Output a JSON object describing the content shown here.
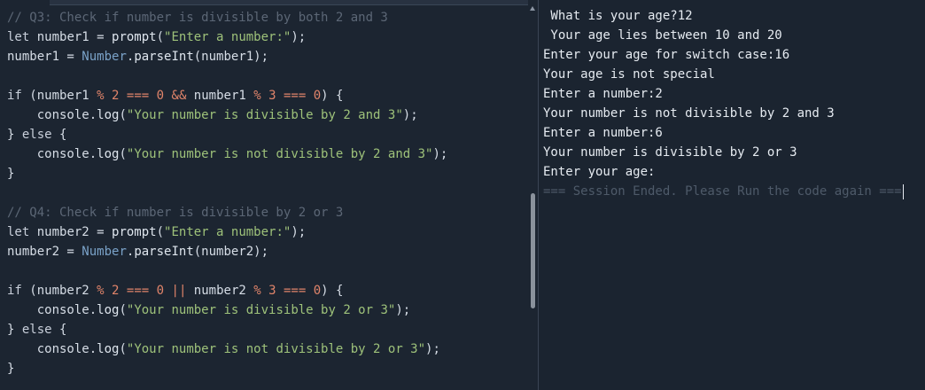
{
  "editor": {
    "lines": [
      [
        {
          "t": "comment",
          "v": "// Q3: Check if number is divisible by both 2 and 3"
        }
      ],
      [
        {
          "t": "keyword",
          "v": "let"
        },
        {
          "t": "plain",
          "v": " number1 = "
        },
        {
          "t": "func",
          "v": "prompt"
        },
        {
          "t": "punc",
          "v": "("
        },
        {
          "t": "string",
          "v": "\"Enter a number:\""
        },
        {
          "t": "punc",
          "v": ");"
        }
      ],
      [
        {
          "t": "plain",
          "v": "number1 = "
        },
        {
          "t": "class",
          "v": "Number"
        },
        {
          "t": "plain",
          "v": "."
        },
        {
          "t": "func",
          "v": "parseInt"
        },
        {
          "t": "punc",
          "v": "(number1);"
        }
      ],
      [],
      [
        {
          "t": "keyword",
          "v": "if"
        },
        {
          "t": "plain",
          "v": " (number1 "
        },
        {
          "t": "op",
          "v": "%"
        },
        {
          "t": "plain",
          "v": " "
        },
        {
          "t": "number",
          "v": "2"
        },
        {
          "t": "plain",
          "v": " "
        },
        {
          "t": "op",
          "v": "==="
        },
        {
          "t": "plain",
          "v": " "
        },
        {
          "t": "number",
          "v": "0"
        },
        {
          "t": "plain",
          "v": " "
        },
        {
          "t": "op",
          "v": "&&"
        },
        {
          "t": "plain",
          "v": " number1 "
        },
        {
          "t": "op",
          "v": "%"
        },
        {
          "t": "plain",
          "v": " "
        },
        {
          "t": "number",
          "v": "3"
        },
        {
          "t": "plain",
          "v": " "
        },
        {
          "t": "op",
          "v": "==="
        },
        {
          "t": "plain",
          "v": " "
        },
        {
          "t": "number",
          "v": "0"
        },
        {
          "t": "plain",
          "v": ") {"
        }
      ],
      [
        {
          "t": "plain",
          "v": "    console."
        },
        {
          "t": "func",
          "v": "log"
        },
        {
          "t": "punc",
          "v": "("
        },
        {
          "t": "string",
          "v": "\"Your number is divisible by 2 and 3\""
        },
        {
          "t": "punc",
          "v": ");"
        }
      ],
      [
        {
          "t": "plain",
          "v": "} "
        },
        {
          "t": "keyword",
          "v": "else"
        },
        {
          "t": "plain",
          "v": " {"
        }
      ],
      [
        {
          "t": "plain",
          "v": "    console."
        },
        {
          "t": "func",
          "v": "log"
        },
        {
          "t": "punc",
          "v": "("
        },
        {
          "t": "string",
          "v": "\"Your number is not divisible by 2 and 3\""
        },
        {
          "t": "punc",
          "v": ");"
        }
      ],
      [
        {
          "t": "plain",
          "v": "}"
        }
      ],
      [],
      [
        {
          "t": "comment",
          "v": "// Q4: Check if number is divisible by 2 or 3"
        }
      ],
      [
        {
          "t": "keyword",
          "v": "let"
        },
        {
          "t": "plain",
          "v": " number2 = "
        },
        {
          "t": "func",
          "v": "prompt"
        },
        {
          "t": "punc",
          "v": "("
        },
        {
          "t": "string",
          "v": "\"Enter a number:\""
        },
        {
          "t": "punc",
          "v": ");"
        }
      ],
      [
        {
          "t": "plain",
          "v": "number2 = "
        },
        {
          "t": "class",
          "v": "Number"
        },
        {
          "t": "plain",
          "v": "."
        },
        {
          "t": "func",
          "v": "parseInt"
        },
        {
          "t": "punc",
          "v": "(number2);"
        }
      ],
      [],
      [
        {
          "t": "keyword",
          "v": "if"
        },
        {
          "t": "plain",
          "v": " (number2 "
        },
        {
          "t": "op",
          "v": "%"
        },
        {
          "t": "plain",
          "v": " "
        },
        {
          "t": "number",
          "v": "2"
        },
        {
          "t": "plain",
          "v": " "
        },
        {
          "t": "op",
          "v": "==="
        },
        {
          "t": "plain",
          "v": " "
        },
        {
          "t": "number",
          "v": "0"
        },
        {
          "t": "plain",
          "v": " "
        },
        {
          "t": "op",
          "v": "||"
        },
        {
          "t": "plain",
          "v": " number2 "
        },
        {
          "t": "op",
          "v": "%"
        },
        {
          "t": "plain",
          "v": " "
        },
        {
          "t": "number",
          "v": "3"
        },
        {
          "t": "plain",
          "v": " "
        },
        {
          "t": "op",
          "v": "==="
        },
        {
          "t": "plain",
          "v": " "
        },
        {
          "t": "number",
          "v": "0"
        },
        {
          "t": "plain",
          "v": ") {"
        }
      ],
      [
        {
          "t": "plain",
          "v": "    console."
        },
        {
          "t": "func",
          "v": "log"
        },
        {
          "t": "punc",
          "v": "("
        },
        {
          "t": "string",
          "v": "\"Your number is divisible by 2 or 3\""
        },
        {
          "t": "punc",
          "v": ");"
        }
      ],
      [
        {
          "t": "plain",
          "v": "} "
        },
        {
          "t": "keyword",
          "v": "else"
        },
        {
          "t": "plain",
          "v": " {"
        }
      ],
      [
        {
          "t": "plain",
          "v": "    console."
        },
        {
          "t": "func",
          "v": "log"
        },
        {
          "t": "punc",
          "v": "("
        },
        {
          "t": "string",
          "v": "\"Your number is not divisible by 2 or 3\""
        },
        {
          "t": "punc",
          "v": ");"
        }
      ],
      [
        {
          "t": "plain",
          "v": "}"
        }
      ]
    ]
  },
  "console": {
    "lines": [
      " What is your age?12",
      " Your age lies between 10 and 20",
      "Enter your age for switch case:16",
      "Your age is not special",
      "Enter a number:2",
      "Your number is not divisible by 2 and 3",
      "Enter a number:6",
      "Your number is divisible by 2 or 3",
      "Enter your age:"
    ],
    "session_ended": "=== Session Ended. Please Run the code again ==="
  },
  "icons": {
    "scroll_up": "triangle-up-icon"
  },
  "colors": {
    "editor_bg": "#1c2531",
    "console_bg": "#1b2430",
    "string": "#9ec27a",
    "number": "#e0846a",
    "comment": "#5c6776",
    "class": "#7aa2c8"
  }
}
